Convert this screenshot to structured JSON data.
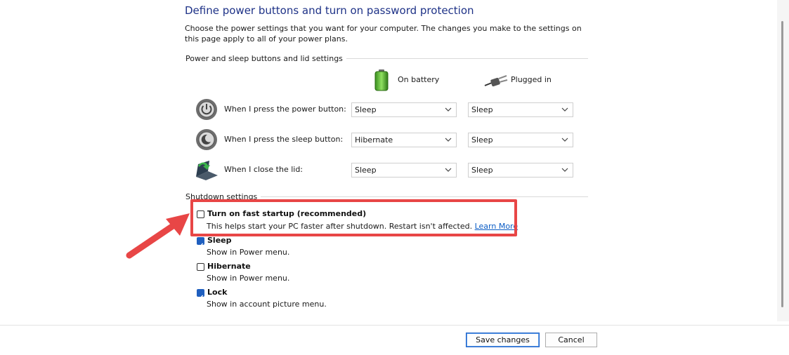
{
  "page": {
    "title": "Define power buttons and turn on password protection",
    "intro": "Choose the power settings that you want for your computer. The changes you make to the settings on this page apply to all of your power plans."
  },
  "buttons_section": {
    "heading": "Power and sleep buttons and lid settings",
    "col_battery": "On battery",
    "col_plugged": "Plugged in",
    "rows": [
      {
        "label": "When I press the power button:",
        "battery": "Sleep",
        "plugged": "Sleep"
      },
      {
        "label": "When I press the sleep button:",
        "battery": "Hibernate",
        "plugged": "Sleep"
      },
      {
        "label": "When I close the lid:",
        "battery": "Sleep",
        "plugged": "Sleep"
      }
    ]
  },
  "shutdown": {
    "heading": "Shutdown settings",
    "items": [
      {
        "label": "Turn on fast startup (recommended)",
        "desc": "This helps start your PC faster after shutdown. Restart isn't affected.",
        "link": "Learn More",
        "checked": false
      },
      {
        "label": "Sleep",
        "desc": "Show in Power menu.",
        "checked": true
      },
      {
        "label": "Hibernate",
        "desc": "Show in Power menu.",
        "checked": false
      },
      {
        "label": "Lock",
        "desc": "Show in account picture menu.",
        "checked": true
      }
    ]
  },
  "footer": {
    "save": "Save changes",
    "cancel": "Cancel"
  },
  "colors": {
    "title": "#1e3287",
    "highlight": "#e84646",
    "check": "#1f5fbf",
    "link": "#0b5cc5"
  },
  "icons": [
    "battery-icon",
    "plug-icon",
    "power-button-icon",
    "sleep-button-icon",
    "lid-icon",
    "chevron-down-icon",
    "arrow-annotation"
  ]
}
